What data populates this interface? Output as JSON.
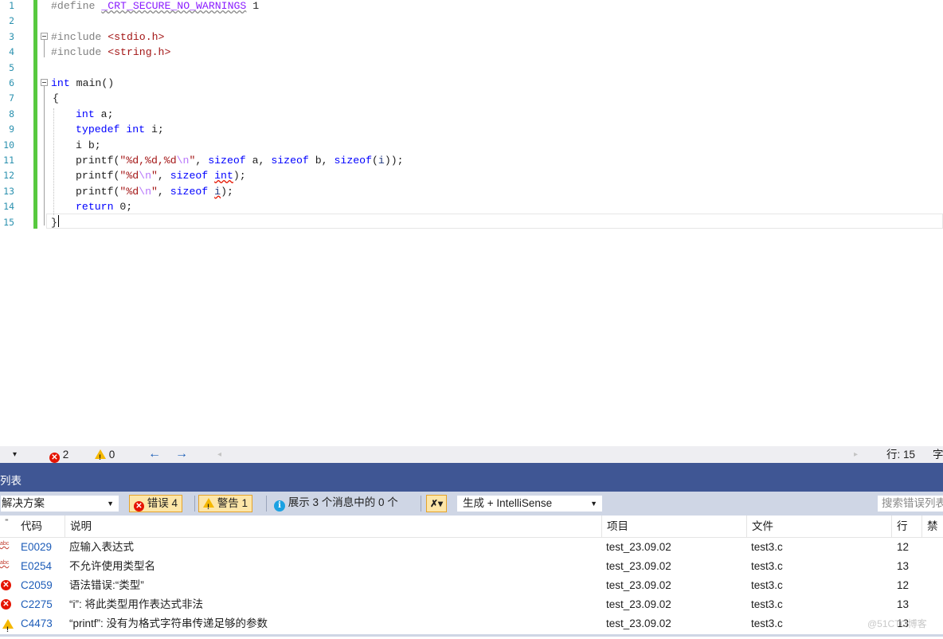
{
  "editor": {
    "line_numbers": [
      "1",
      "2",
      "3",
      "4",
      "5",
      "6",
      "7",
      "8",
      "9",
      "10",
      "11",
      "12",
      "13",
      "14",
      "15"
    ],
    "lines": {
      "l1_define": "#define ",
      "l1_macro": "_CRT_SECURE_NO_WARNINGS",
      "l1_value": " 1",
      "l3_include": "#include ",
      "l3_header": "<stdio.h>",
      "l4_include": "#include ",
      "l4_header": "<string.h>",
      "l6_kw": "int",
      "l6_rest": " main()",
      "l7": "{",
      "l8_kw": "int",
      "l8_rest": " a;",
      "l9_kw1": "typedef",
      "l9_kw2": "int",
      "l9_rest": " i;",
      "l10": "i b;",
      "l11_fn": "printf(",
      "l11_str1": "\"%d,%d,%d",
      "l11_esc": "\\n",
      "l11_str2": "\"",
      "l11_mid1": ", ",
      "l11_sz1": "sizeof",
      "l11_mid2": " a, ",
      "l11_sz2": "sizeof",
      "l11_mid3": " b, ",
      "l11_sz3": "sizeof",
      "l11_paren": "(",
      "l11_i": "i",
      "l11_end": "));",
      "l12_fn": "printf(",
      "l12_str1": "\"%d",
      "l12_esc": "\\n",
      "l12_str2": "\"",
      "l12_mid": ", ",
      "l12_sz": "sizeof",
      "l12_sp": " ",
      "l12_int": "int",
      "l12_end": ");",
      "l13_fn": "printf(",
      "l13_str1": "\"%d",
      "l13_esc": "\\n",
      "l13_str2": "\"",
      "l13_mid": ", ",
      "l13_sz": "sizeof",
      "l13_sp": " ",
      "l13_i": "i",
      "l13_end": ");",
      "l14_kw": "return",
      "l14_rest": " 0;",
      "l15": "}"
    }
  },
  "status_strip": {
    "error_count": "2",
    "warning_count": "0",
    "back_arrow": "←",
    "forward_arrow": "→",
    "line_col": "行: 15",
    "char_label": "字"
  },
  "error_list": {
    "title": "列表",
    "scope_combo": "解决方案",
    "errors_button": "错误 4",
    "warnings_button": "警告 1",
    "messages_button": "展示 3 个消息中的 0 个",
    "build_combo": "生成 + IntelliSense",
    "search_placeholder": "搜索错误列表",
    "columns": {
      "code": "代码",
      "description": "说明",
      "project": "项目",
      "file": "文件",
      "line": "行",
      "suppress": "禁"
    },
    "rows": [
      {
        "icon": "abc-squiggle-icon",
        "code": "E0029",
        "description": "应输入表达式",
        "project": "test_23.09.02",
        "file": "test3.c",
        "line": "12"
      },
      {
        "icon": "abc-squiggle-icon",
        "code": "E0254",
        "description": "不允许使用类型名",
        "project": "test_23.09.02",
        "file": "test3.c",
        "line": "13"
      },
      {
        "icon": "error-icon",
        "code": "C2059",
        "description": "语法错误:“类型”",
        "project": "test_23.09.02",
        "file": "test3.c",
        "line": "12"
      },
      {
        "icon": "error-icon",
        "code": "C2275",
        "description": "“i”: 将此类型用作表达式非法",
        "project": "test_23.09.02",
        "file": "test3.c",
        "line": "13"
      },
      {
        "icon": "warning-icon",
        "code": "C4473",
        "description": "“printf”: 没有为格式字符串传递足够的参数",
        "project": "test_23.09.02",
        "file": "test3.c",
        "line": "13"
      }
    ]
  },
  "watermark": "@51CTO博客",
  "colors": {
    "panel_title_bg": "#3f5694",
    "toolbar_bg": "#cfd6e5",
    "keyword": "#0000ff",
    "string": "#a31515",
    "macro": "#8a1bff",
    "error_red": "#e51400",
    "warning_yellow": "#f5b800",
    "change_bar_green": "#57c93f"
  }
}
